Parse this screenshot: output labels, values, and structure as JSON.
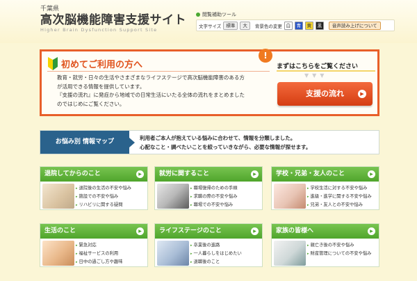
{
  "header": {
    "prefecture": "千葉県",
    "title": "高次脳機能障害支援サイト",
    "subtitle": "Higher Brain Dysfunction Support Site"
  },
  "tools": {
    "title": "閲覧補助ツール",
    "font_size_label": "文字サイズ",
    "font_standard": "標準",
    "font_large": "大",
    "bg_color_label": "背景色の変更",
    "bg_white": "白",
    "bg_blue": "青",
    "bg_yellow": "黄",
    "bg_black": "黒",
    "voice_button": "音声読み上げについて"
  },
  "intro": {
    "title": "初めてご利用の方へ",
    "line1": "教育・就労・日々の生活やさまざまなライフステージで高次脳機能障害のある方",
    "line2": "が活用できる情報を提供しています。",
    "line3": "『支援の流れ』に発症から地域での日常生活にいたる全体の流れをまとめました",
    "line4": "のではじめにご覧ください。",
    "please_see": "まずはこちらをご覧ください",
    "support_flow_button": "支援の流れ"
  },
  "map": {
    "label": "お悩み別 情報マップ",
    "line1": "利用者ご本人が抱えている悩みに合わせて、情報を分類しました。",
    "line2": "心配なこと・調べたいことを絞っていきながら、必要な情報が探せます。"
  },
  "cards": [
    {
      "title": "退院してからのこと",
      "items": [
        "退院後の生活の不安や悩み",
        "施設での不安や悩み",
        "リハビリに関する疑問"
      ]
    },
    {
      "title": "就労に関すること",
      "items": [
        "職場復帰のための手順",
        "求職の際の不安や悩み",
        "職場での不安や悩み"
      ]
    },
    {
      "title": "学校・兄弟・友人のこと",
      "items": [
        "学校生活に対する不安や悩み",
        "進級・進学に関する不安や悩み",
        "兄弟・友人との不安や悩み"
      ]
    },
    {
      "title": "生活のこと",
      "items": [
        "緊急対応",
        "福祉サービスの利用",
        "日中の過ごし方や趣味"
      ]
    },
    {
      "title": "ライフステージのこと",
      "items": [
        "卒業後の進路",
        "一人暮らしをはじめたい",
        "退職後のこと"
      ]
    },
    {
      "title": "家族の皆様へ",
      "items": [
        "親亡き後の不安や悩み",
        "財産管理についての不安や悩み"
      ]
    }
  ],
  "colors": {
    "accent_orange": "#e85f2a",
    "map_blue": "#2a628c",
    "card_green": "#4fa52c"
  }
}
